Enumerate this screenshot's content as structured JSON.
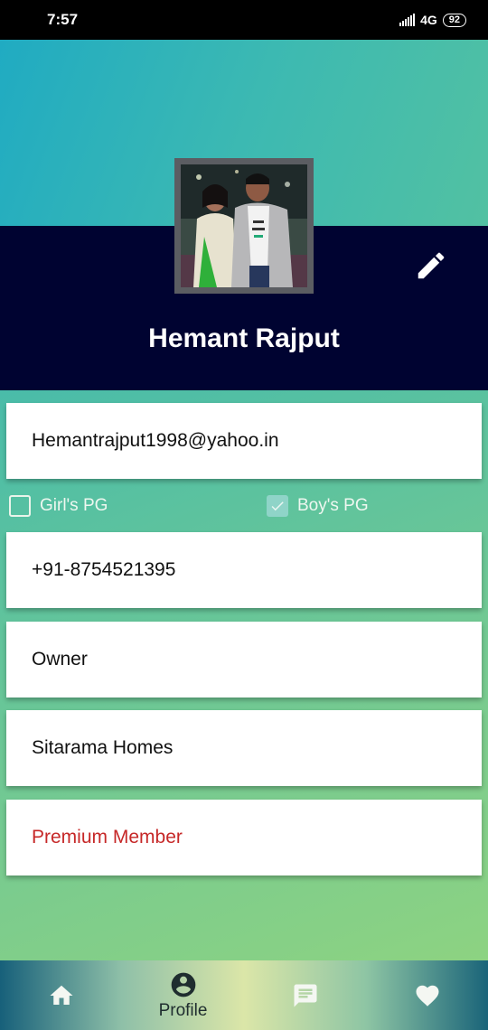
{
  "status_bar": {
    "time": "7:57",
    "network": "4G",
    "battery": "92"
  },
  "profile": {
    "name": "Hemant Rajput"
  },
  "fields": {
    "email": "Hemantrajput1998@yahoo.in",
    "phone": "+91-8754521395",
    "role": "Owner",
    "property": "Sitarama Homes",
    "membership": "Premium Member"
  },
  "checkboxes": [
    {
      "label": "Girl's PG",
      "checked": false
    },
    {
      "label": "Boy's PG",
      "checked": true
    }
  ],
  "bottom_nav": {
    "items": [
      {
        "icon": "home-icon",
        "label": ""
      },
      {
        "icon": "account-circle-icon",
        "label": "Profile"
      },
      {
        "icon": "chat-icon",
        "label": ""
      },
      {
        "icon": "heart-icon",
        "label": ""
      }
    ]
  },
  "colors": {
    "header_dark": "#000331",
    "premium_text": "#c62828"
  }
}
